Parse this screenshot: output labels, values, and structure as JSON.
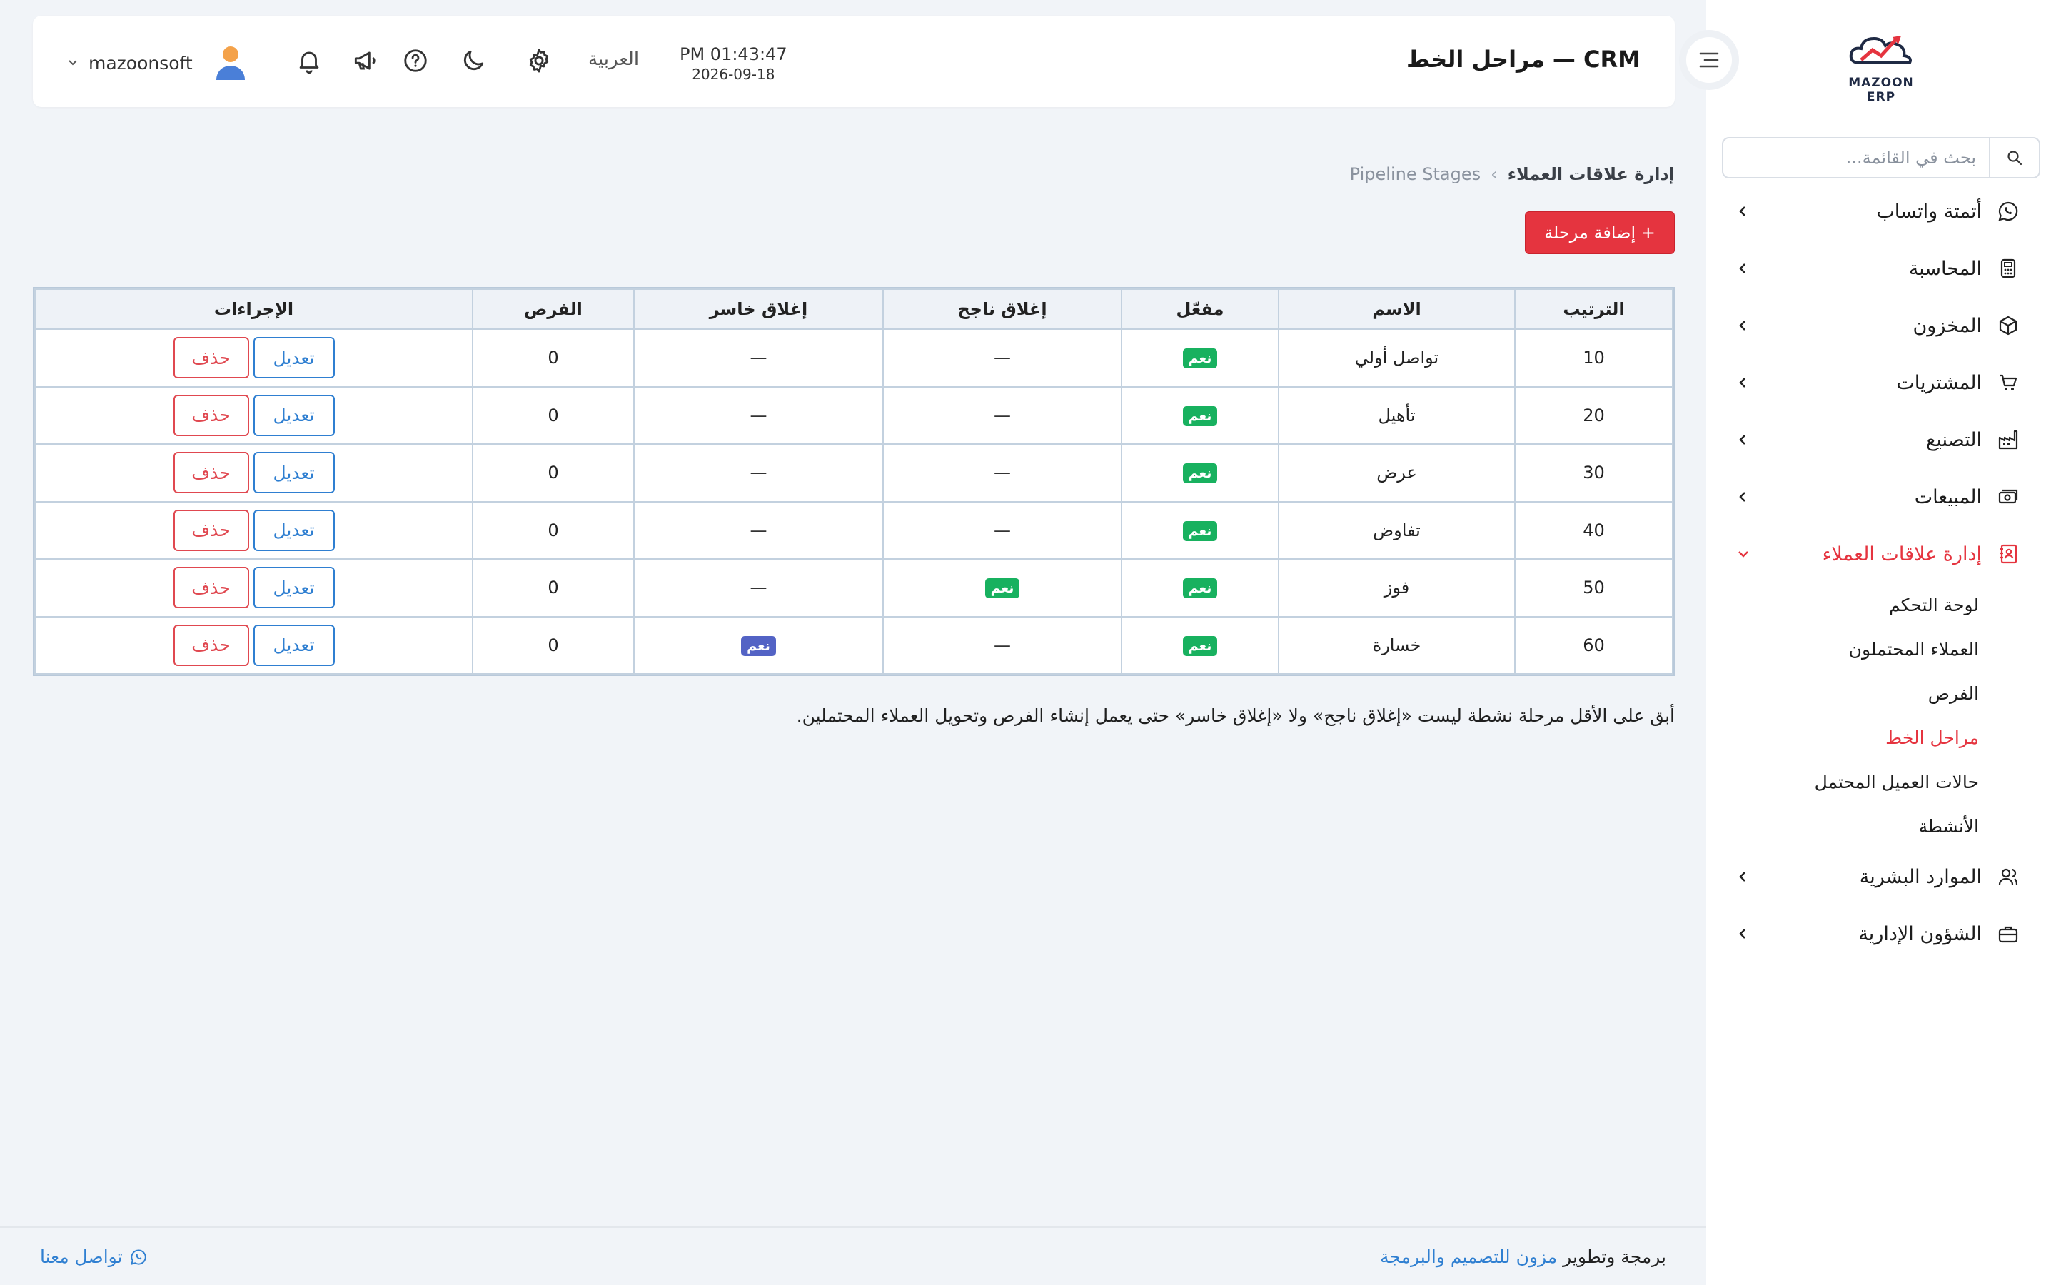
{
  "brand": {
    "logo_text": "MAZOON ERP",
    "logo_sub": "ERP"
  },
  "search": {
    "placeholder": "بحث في القائمة..."
  },
  "sidebar": {
    "items": [
      {
        "label": "أتمتة واتساب",
        "icon": "whatsapp-icon"
      },
      {
        "label": "المحاسبة",
        "icon": "calculator-icon"
      },
      {
        "label": "المخزون",
        "icon": "box-icon"
      },
      {
        "label": "المشتريات",
        "icon": "cart-icon"
      },
      {
        "label": "التصنيع",
        "icon": "factory-icon"
      },
      {
        "label": "المبيعات",
        "icon": "money-icon"
      },
      {
        "label": "إدارة علاقات العملاء",
        "icon": "contacts-icon"
      },
      {
        "label": "الموارد البشرية",
        "icon": "users-icon"
      },
      {
        "label": "الشؤون الإدارية",
        "icon": "briefcase-icon"
      }
    ],
    "crm_sub": [
      "لوحة التحكم",
      "العملاء المحتملون",
      "الفرص",
      "مراحل الخط",
      "حالات العميل المحتمل",
      "الأنشطة"
    ]
  },
  "header": {
    "title": "CRM — مراحل الخط",
    "time": "PM 01:43:47",
    "date": "2026-09-18",
    "language": "العربية",
    "username": "mazoonsoft"
  },
  "breadcrumb": {
    "root": "إدارة علاقات العملاء",
    "sep": "›",
    "current": "Pipeline Stages"
  },
  "add_button": "+ إضافة مرحلة",
  "table": {
    "headers": [
      "الترتيب",
      "الاسم",
      "مفعّل",
      "إغلاق ناجح",
      "إغلاق خاسر",
      "الفرص",
      "الإجراءات"
    ],
    "edit_label": "تعديل",
    "delete_label": "حذف",
    "yes": "نعم",
    "dash": "—",
    "rows": [
      {
        "order": "10",
        "name": "تواصل أولي",
        "active": "نعم",
        "won": "—",
        "lost": "—",
        "opps": "0"
      },
      {
        "order": "20",
        "name": "تأهيل",
        "active": "نعم",
        "won": "—",
        "lost": "—",
        "opps": "0"
      },
      {
        "order": "30",
        "name": "عرض",
        "active": "نعم",
        "won": "—",
        "lost": "—",
        "opps": "0"
      },
      {
        "order": "40",
        "name": "تفاوض",
        "active": "نعم",
        "won": "—",
        "lost": "—",
        "opps": "0"
      },
      {
        "order": "50",
        "name": "فوز",
        "active": "نعم",
        "won": "نعم",
        "lost": "—",
        "opps": "0"
      },
      {
        "order": "60",
        "name": "خسارة",
        "active": "نعم",
        "won": "—",
        "lost": "نعم",
        "opps": "0"
      }
    ]
  },
  "note": "أبق على الأقل مرحلة نشطة ليست «إغلاق ناجح» ولا «إغلاق خاسر» حتى يعمل إنشاء الفرص وتحويل العملاء المحتملين.",
  "footer": {
    "credit_prefix": "برمجة وتطوير",
    "credit_link": "مزون للتصميم والبرمجة",
    "contact": "تواصل معنا"
  },
  "colors": {
    "accent": "#e5343f",
    "link": "#2f7fd1",
    "success": "#18b15f",
    "indigo": "#5363c5"
  }
}
